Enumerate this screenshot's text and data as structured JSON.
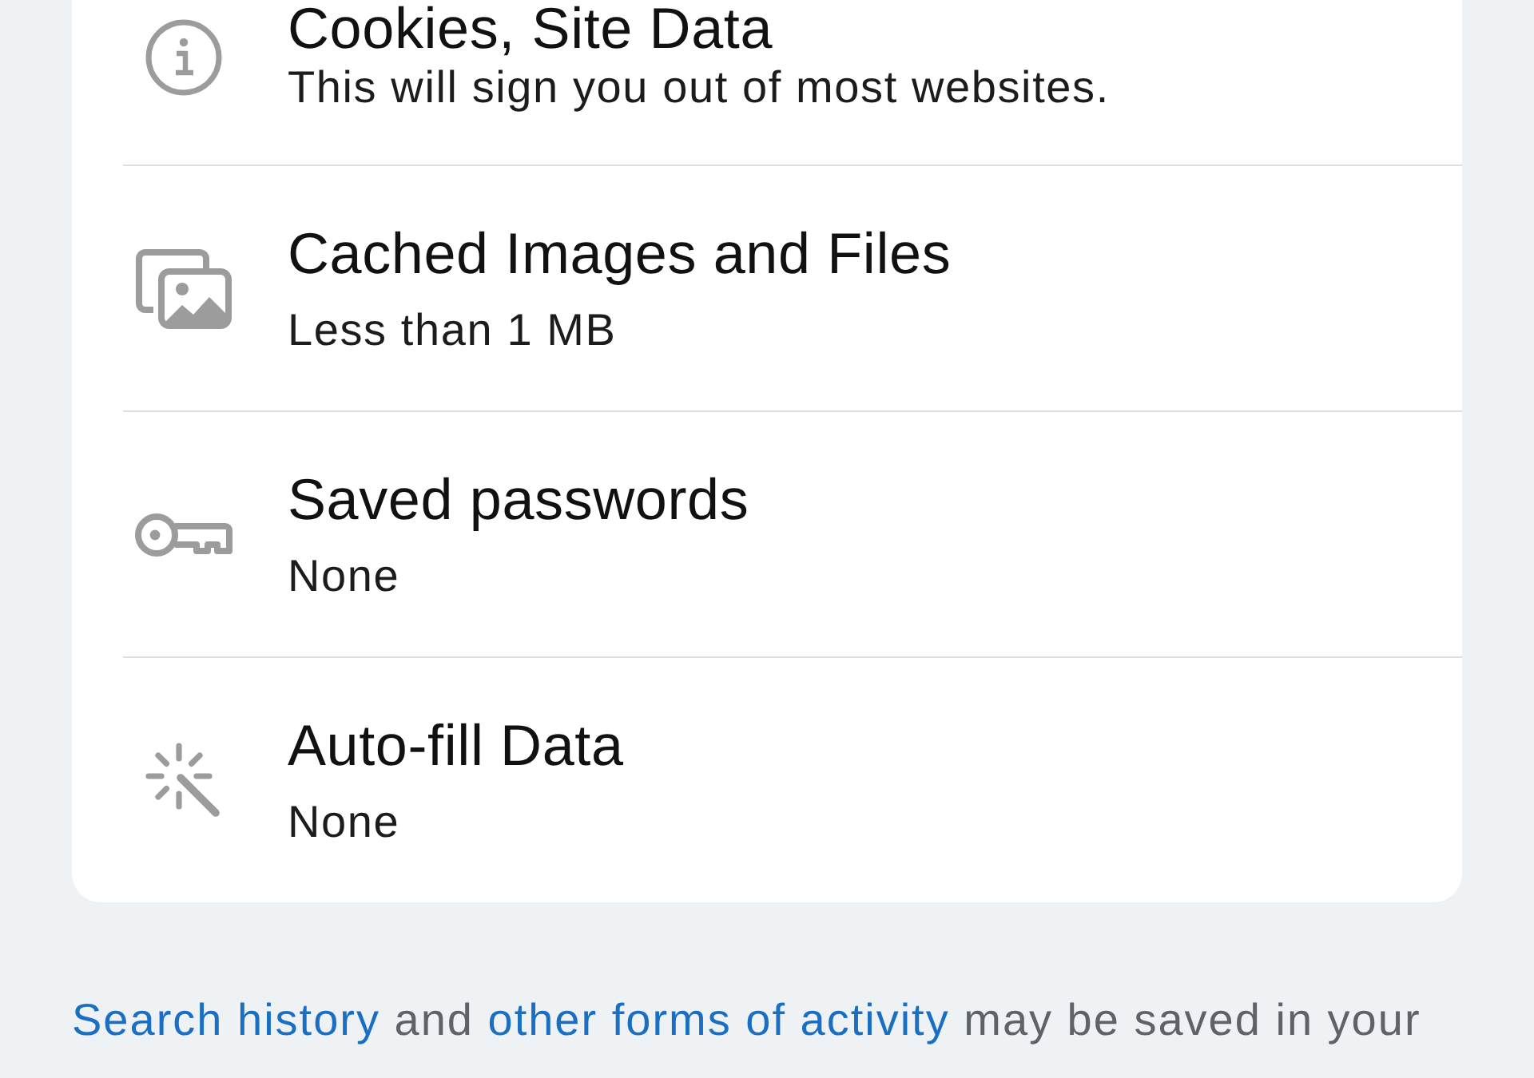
{
  "items": [
    {
      "kind": "info",
      "title": "Cookies, Site Data",
      "subtitle": "This will sign you out of most websites."
    },
    {
      "kind": "images",
      "title": "Cached Images and Files",
      "subtitle": "Less than 1 MB"
    },
    {
      "kind": "key",
      "title": "Saved passwords",
      "subtitle": "None"
    },
    {
      "kind": "wand",
      "title": "Auto-fill Data",
      "subtitle": "None"
    }
  ],
  "footer": {
    "parts": [
      {
        "kind": "link",
        "text": "Search history"
      },
      {
        "kind": "text",
        "text": "and"
      },
      {
        "kind": "link",
        "text": "other forms of activity"
      },
      {
        "kind": "text",
        "text": "may be saved in your"
      }
    ]
  }
}
